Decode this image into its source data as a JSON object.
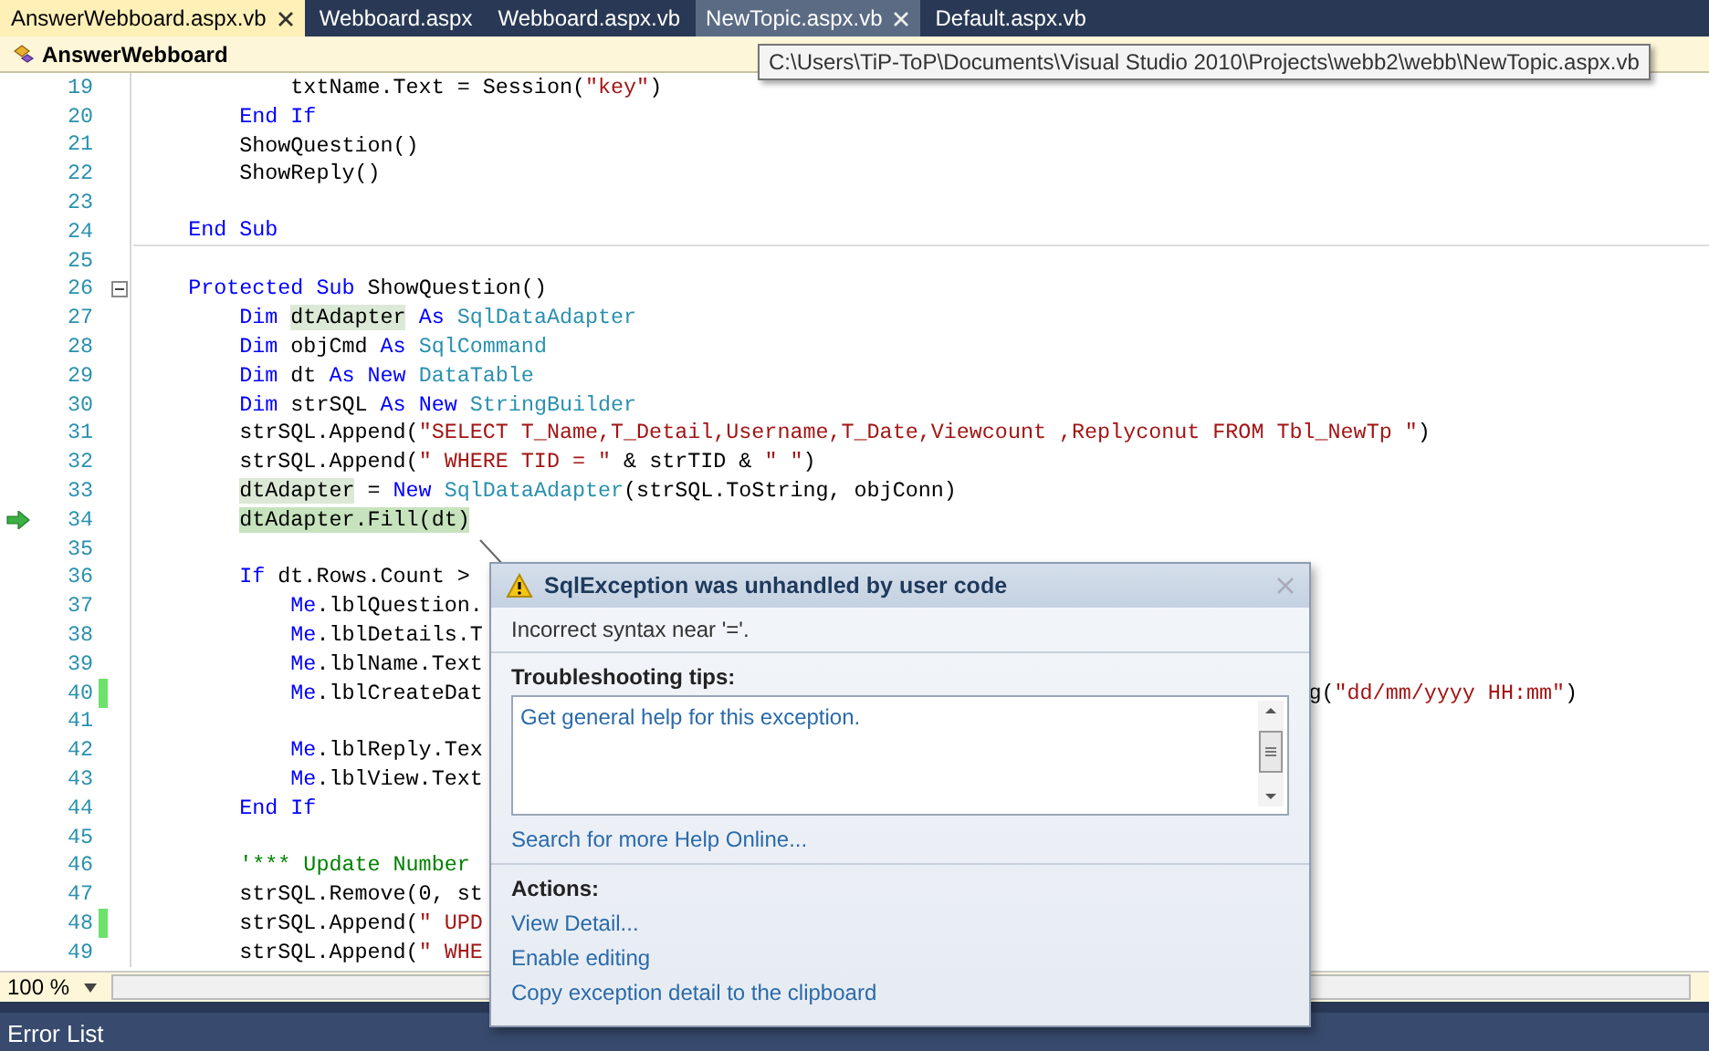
{
  "tabs": [
    {
      "label": "AnswerWebboard.aspx.vb",
      "selected": true,
      "hovered": false,
      "closable": true
    },
    {
      "label": "Webboard.aspx",
      "selected": false,
      "hovered": false,
      "closable": false
    },
    {
      "label": "Webboard.aspx.vb",
      "selected": false,
      "hovered": false,
      "closable": false
    },
    {
      "label": "NewTopic.aspx.vb",
      "selected": false,
      "hovered": true,
      "closable": true
    },
    {
      "label": "Default.aspx.vb",
      "selected": false,
      "hovered": false,
      "closable": false
    }
  ],
  "nav_bar": {
    "class_name": "AnswerWebboard"
  },
  "tooltip": {
    "text": "C:\\Users\\TiP-ToP\\Documents\\Visual Studio 2010\\Projects\\webb2\\webb\\NewTopic.aspx.vb"
  },
  "editor": {
    "lines": [
      {
        "number": "19",
        "changed": false,
        "current": false,
        "collapsible": false,
        "tokens": [
          {
            "text": "            txtName.Text = Session(",
            "kind": "plain"
          },
          {
            "text": "\"key\"",
            "kind": "string"
          },
          {
            "text": ")",
            "kind": "plain"
          }
        ]
      },
      {
        "number": "20",
        "changed": false,
        "current": false,
        "collapsible": false,
        "tokens": [
          {
            "text": "        End If",
            "kind": "keyword"
          }
        ]
      },
      {
        "number": "21",
        "changed": false,
        "current": false,
        "collapsible": false,
        "tokens": [
          {
            "text": "        ShowQuestion()",
            "kind": "plain"
          }
        ]
      },
      {
        "number": "22",
        "changed": false,
        "current": false,
        "collapsible": false,
        "tokens": [
          {
            "text": "        ShowReply()",
            "kind": "plain"
          }
        ]
      },
      {
        "number": "23",
        "changed": false,
        "current": false,
        "collapsible": false
      },
      {
        "number": "24",
        "changed": false,
        "current": false,
        "collapsible": false,
        "tokens": [
          {
            "text": "    End Sub",
            "kind": "keyword"
          }
        ]
      },
      {
        "number": "25",
        "changed": false,
        "current": false,
        "collapsible": false
      },
      {
        "number": "26",
        "changed": false,
        "current": false,
        "collapsible": true,
        "tokens": [
          {
            "text": "    Protected Sub",
            "kind": "keyword"
          },
          {
            "text": " ShowQuestion()",
            "kind": "plain"
          }
        ]
      },
      {
        "number": "27",
        "changed": false,
        "current": false,
        "collapsible": false,
        "tokens": [
          {
            "text": "        Dim ",
            "kind": "keyword"
          },
          {
            "text": "dtAdapter",
            "kind": "reference"
          },
          {
            "text": " As ",
            "kind": "keyword"
          },
          {
            "text": "SqlDataAdapter",
            "kind": "type"
          }
        ]
      },
      {
        "number": "28",
        "changed": false,
        "current": false,
        "collapsible": false,
        "tokens": [
          {
            "text": "        Dim",
            "kind": "keyword"
          },
          {
            "text": " objCmd ",
            "kind": "plain"
          },
          {
            "text": "As ",
            "kind": "keyword"
          },
          {
            "text": "SqlCommand",
            "kind": "type"
          }
        ]
      },
      {
        "number": "29",
        "changed": false,
        "current": false,
        "collapsible": false,
        "tokens": [
          {
            "text": "        Dim",
            "kind": "keyword"
          },
          {
            "text": " dt ",
            "kind": "plain"
          },
          {
            "text": "As New ",
            "kind": "keyword"
          },
          {
            "text": "DataTable",
            "kind": "type"
          }
        ]
      },
      {
        "number": "30",
        "changed": false,
        "current": false,
        "collapsible": false,
        "tokens": [
          {
            "text": "        Dim",
            "kind": "keyword"
          },
          {
            "text": " strSQL ",
            "kind": "plain"
          },
          {
            "text": "As New ",
            "kind": "keyword"
          },
          {
            "text": "StringBuilder",
            "kind": "type"
          }
        ]
      },
      {
        "number": "31",
        "changed": false,
        "current": false,
        "collapsible": false,
        "tokens": [
          {
            "text": "        strSQL.Append(",
            "kind": "plain"
          },
          {
            "text": "\"SELECT T_Name,T_Detail,Username,T_Date,Viewcount ,Replyconut FROM Tbl_NewTp \"",
            "kind": "string"
          },
          {
            "text": ")",
            "kind": "plain"
          }
        ]
      },
      {
        "number": "32",
        "changed": false,
        "current": false,
        "collapsible": false,
        "tokens": [
          {
            "text": "        strSQL.Append(",
            "kind": "plain"
          },
          {
            "text": "\" WHERE TID = \"",
            "kind": "string"
          },
          {
            "text": " & strTID & ",
            "kind": "plain"
          },
          {
            "text": "\" \"",
            "kind": "string"
          },
          {
            "text": ")",
            "kind": "plain"
          }
        ]
      },
      {
        "number": "33",
        "changed": false,
        "current": false,
        "collapsible": false,
        "tokens": [
          {
            "text": "        dtAdapter",
            "kind": "reference"
          },
          {
            "text": " = ",
            "kind": "plain"
          },
          {
            "text": "New ",
            "kind": "keyword"
          },
          {
            "text": "SqlDataAdapter",
            "kind": "type"
          },
          {
            "text": "(strSQL.ToString, objConn)",
            "kind": "plain"
          }
        ]
      },
      {
        "number": "34",
        "changed": false,
        "current": true,
        "collapsible": false,
        "tokens": [
          {
            "text": "        dtAdapter.Fill(dt)",
            "kind": "statement"
          }
        ]
      },
      {
        "number": "35",
        "changed": false,
        "current": false,
        "collapsible": false
      },
      {
        "number": "36",
        "changed": false,
        "current": false,
        "collapsible": false,
        "tokens": [
          {
            "text": "        If",
            "kind": "keyword"
          },
          {
            "text": " dt.Rows.Count >",
            "kind": "plain"
          }
        ]
      },
      {
        "number": "37",
        "changed": false,
        "current": false,
        "collapsible": false,
        "tokens": [
          {
            "text": "            Me",
            "kind": "keyword"
          },
          {
            "text": ".lblQuestion.",
            "kind": "plain"
          }
        ]
      },
      {
        "number": "38",
        "changed": false,
        "current": false,
        "collapsible": false,
        "tokens": [
          {
            "text": "            Me",
            "kind": "keyword"
          },
          {
            "text": ".lblDetails.T",
            "kind": "plain"
          }
        ]
      },
      {
        "number": "39",
        "changed": false,
        "current": false,
        "collapsible": false,
        "tokens": [
          {
            "text": "            Me",
            "kind": "keyword"
          },
          {
            "text": ".lblName.Text",
            "kind": "plain"
          }
        ]
      },
      {
        "number": "40",
        "changed": true,
        "current": false,
        "collapsible": false,
        "tokens": [
          {
            "text": "            Me",
            "kind": "keyword"
          },
          {
            "text": ".lblCreateDat",
            "kind": "plain"
          }
        ],
        "tail_tokens": [
          {
            "text": "g(",
            "kind": "plain"
          },
          {
            "text": "\"dd/mm/yyyy HH:mm\"",
            "kind": "string"
          },
          {
            "text": ")",
            "kind": "plain"
          }
        ]
      },
      {
        "number": "41",
        "changed": false,
        "current": false,
        "collapsible": false
      },
      {
        "number": "42",
        "changed": false,
        "current": false,
        "collapsible": false,
        "tokens": [
          {
            "text": "            Me",
            "kind": "keyword"
          },
          {
            "text": ".lblReply.Tex",
            "kind": "plain"
          }
        ]
      },
      {
        "number": "43",
        "changed": false,
        "current": false,
        "collapsible": false,
        "tokens": [
          {
            "text": "            Me",
            "kind": "keyword"
          },
          {
            "text": ".lblView.Text",
            "kind": "plain"
          }
        ]
      },
      {
        "number": "44",
        "changed": false,
        "current": false,
        "collapsible": false,
        "tokens": [
          {
            "text": "        End If",
            "kind": "keyword"
          }
        ]
      },
      {
        "number": "45",
        "changed": false,
        "current": false,
        "collapsible": false
      },
      {
        "number": "46",
        "changed": false,
        "current": false,
        "collapsible": false,
        "tokens": [
          {
            "text": "        '*** Update Number",
            "kind": "comment"
          }
        ]
      },
      {
        "number": "47",
        "changed": false,
        "current": false,
        "collapsible": false,
        "tokens": [
          {
            "text": "        strSQL.Remove(0, st",
            "kind": "plain"
          }
        ]
      },
      {
        "number": "48",
        "changed": true,
        "current": false,
        "collapsible": false,
        "tokens": [
          {
            "text": "        strSQL.Append(",
            "kind": "plain"
          },
          {
            "text": "\" UPD",
            "kind": "string"
          }
        ]
      },
      {
        "number": "49",
        "changed": false,
        "current": false,
        "collapsible": false,
        "tokens": [
          {
            "text": "        strSQL.Append(",
            "kind": "plain"
          },
          {
            "text": "\" WHE",
            "kind": "string"
          }
        ]
      }
    ]
  },
  "zoom": {
    "value": "100 %"
  },
  "exception_popup": {
    "title": "SqlException was unhandled by user code",
    "message": "Incorrect syntax near '='.",
    "tips_heading": "Troubleshooting tips:",
    "tips": [
      "Get general help for this exception."
    ],
    "help_link": "Search for more Help Online...",
    "actions_heading": "Actions:",
    "actions": [
      "View Detail...",
      "Enable editing",
      "Copy exception detail to the clipboard"
    ]
  },
  "bottom_panel": {
    "title": "Error List"
  }
}
